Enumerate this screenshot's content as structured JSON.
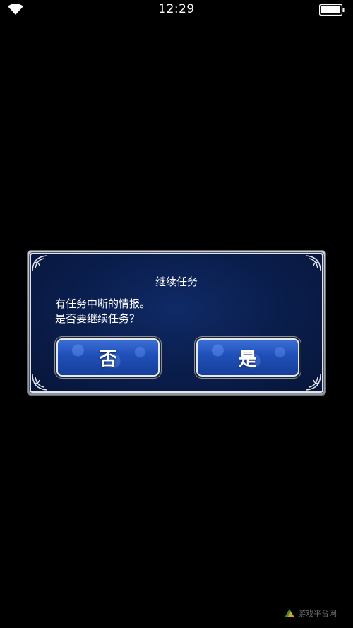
{
  "status_bar": {
    "time": "12:29",
    "wifi_icon": "wifi-icon",
    "battery_icon": "battery-icon"
  },
  "dialog": {
    "title": "继续任务",
    "message_line1": "有任务中断的情报。",
    "message_line2": "是否要继续任务？",
    "no_label": "否",
    "yes_label": "是"
  },
  "watermark": {
    "text": "游戏平台网"
  },
  "colors": {
    "background": "#000000",
    "dialog_fill": "#0a1d4a",
    "button_fill": "#1f4fb8",
    "frame": "#c8ccd4"
  }
}
